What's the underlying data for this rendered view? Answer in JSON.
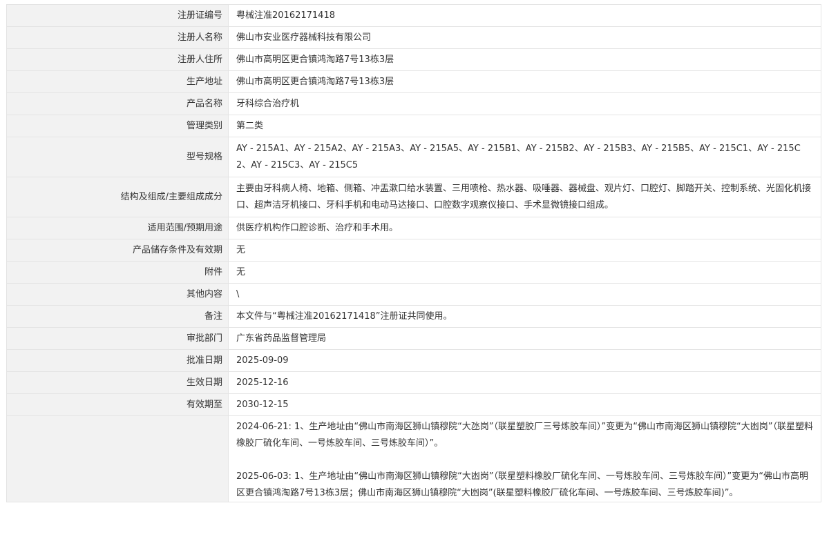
{
  "rows": [
    {
      "label": "注册证编号",
      "value": "粤械注准20162171418"
    },
    {
      "label": "注册人名称",
      "value": "佛山市安业医疗器械科技有限公司"
    },
    {
      "label": "注册人住所",
      "value": "佛山市高明区更合镇鸿淘路7号13栋3层"
    },
    {
      "label": "生产地址",
      "value": "佛山市高明区更合镇鸿淘路7号13栋3层"
    },
    {
      "label": "产品名称",
      "value": "牙科综合治疗机"
    },
    {
      "label": "管理类别",
      "value": "第二类"
    },
    {
      "label": "型号规格",
      "value": "AY - 215A1、AY - 215A2、AY - 215A3、AY - 215A5、AY - 215B1、AY - 215B2、AY - 215B3、AY - 215B5、AY - 215C1、AY - 215C2、AY - 215C3、AY - 215C5"
    },
    {
      "label": "结构及组成/主要组成成分",
      "value": "主要由牙科病人椅、地箱、侧箱、冲盂漱口给水装置、三用喷枪、热水器、吸唾器、器械盘、观片灯、口腔灯、脚踏开关、控制系统、光固化机接口、超声洁牙机接口、牙科手机和电动马达接口、口腔数字观察仪接口、手术显微镜接口组成。"
    },
    {
      "label": "适用范围/预期用途",
      "value": "供医疗机构作口腔诊断、治疗和手术用。"
    },
    {
      "label": "产品储存条件及有效期",
      "value": "无"
    },
    {
      "label": "附件",
      "value": "无"
    },
    {
      "label": "其他内容",
      "value": "\\"
    },
    {
      "label": "备注",
      "value": "本文件与“粤械注准20162171418”注册证共同使用。"
    },
    {
      "label": "审批部门",
      "value": "广东省药品监督管理局"
    },
    {
      "label": "批准日期",
      "value": "2025-09-09"
    },
    {
      "label": "生效日期",
      "value": "2025-12-16"
    },
    {
      "label": "有效期至",
      "value": "2030-12-15"
    }
  ],
  "changes": {
    "label": "",
    "entries": [
      "2024-06-21: 1、生产地址由“佛山市南海区狮山镇穆院“大氹岗”（联星塑胶厂三号炼胶车间）”变更为“佛山市南海区狮山镇穆院“大凼岗”（联星塑料橡胶厂硫化车间、一号炼胶车间、三号炼胶车间）”。",
      "2025-06-03: 1、生产地址由“佛山市南海区狮山镇穆院“大凼岗”（联星塑料橡胶厂硫化车间、一号炼胶车间、三号炼胶车间）”变更为“佛山市高明区更合镇鸿淘路7号13栋3层；佛山市南海区狮山镇穆院“大凼岗”(联星塑料橡胶厂硫化车间、一号炼胶车间、三号炼胶车间)”。"
    ]
  }
}
